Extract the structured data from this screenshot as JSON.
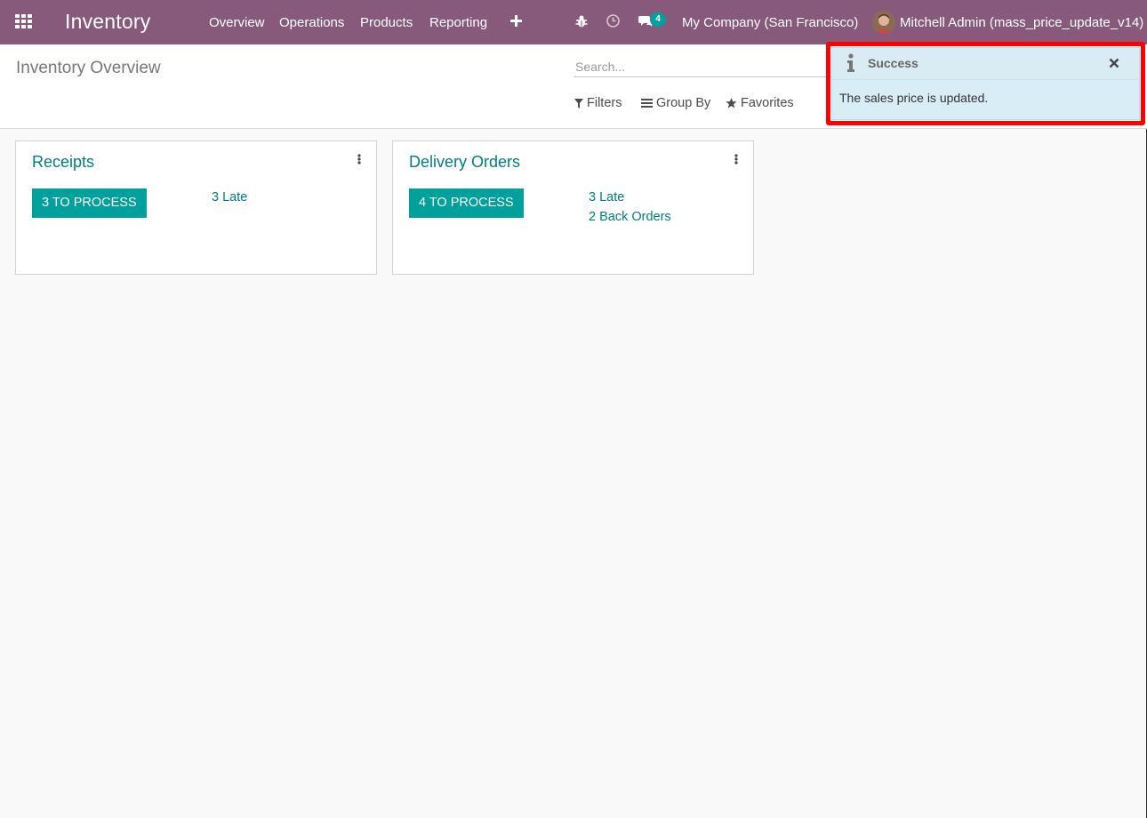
{
  "navbar": {
    "app_name": "Inventory",
    "menu": [
      {
        "label": "Overview"
      },
      {
        "label": "Operations"
      },
      {
        "label": "Products"
      },
      {
        "label": "Reporting"
      }
    ],
    "icons": [
      "apps-grid-icon",
      "plus-icon",
      "bug-icon",
      "clock-icon",
      "chat-icon"
    ],
    "messages_count": "4",
    "company": "My Company (San Francisco)",
    "user": "Mitchell Admin (mass_price_update_v14)"
  },
  "control_panel": {
    "title": "Inventory Overview",
    "search_placeholder": "Search...",
    "filters_label": "Filters",
    "group_by_label": "Group By",
    "favorites_label": "Favorites"
  },
  "cards": [
    {
      "title": "Receipts",
      "process_label": "3 To Process",
      "links": [
        "3 Late"
      ]
    },
    {
      "title": "Delivery Orders",
      "process_label": "4 To Process",
      "links": [
        "3 Late",
        "2 Back Orders"
      ]
    }
  ],
  "notification": {
    "title": "Success",
    "message": "The sales price is updated.",
    "icon": "info-icon"
  },
  "colors": {
    "navbar": "#875a7b",
    "accent": "#00a09d",
    "link": "#017e84",
    "highlight": "#ff0000"
  }
}
